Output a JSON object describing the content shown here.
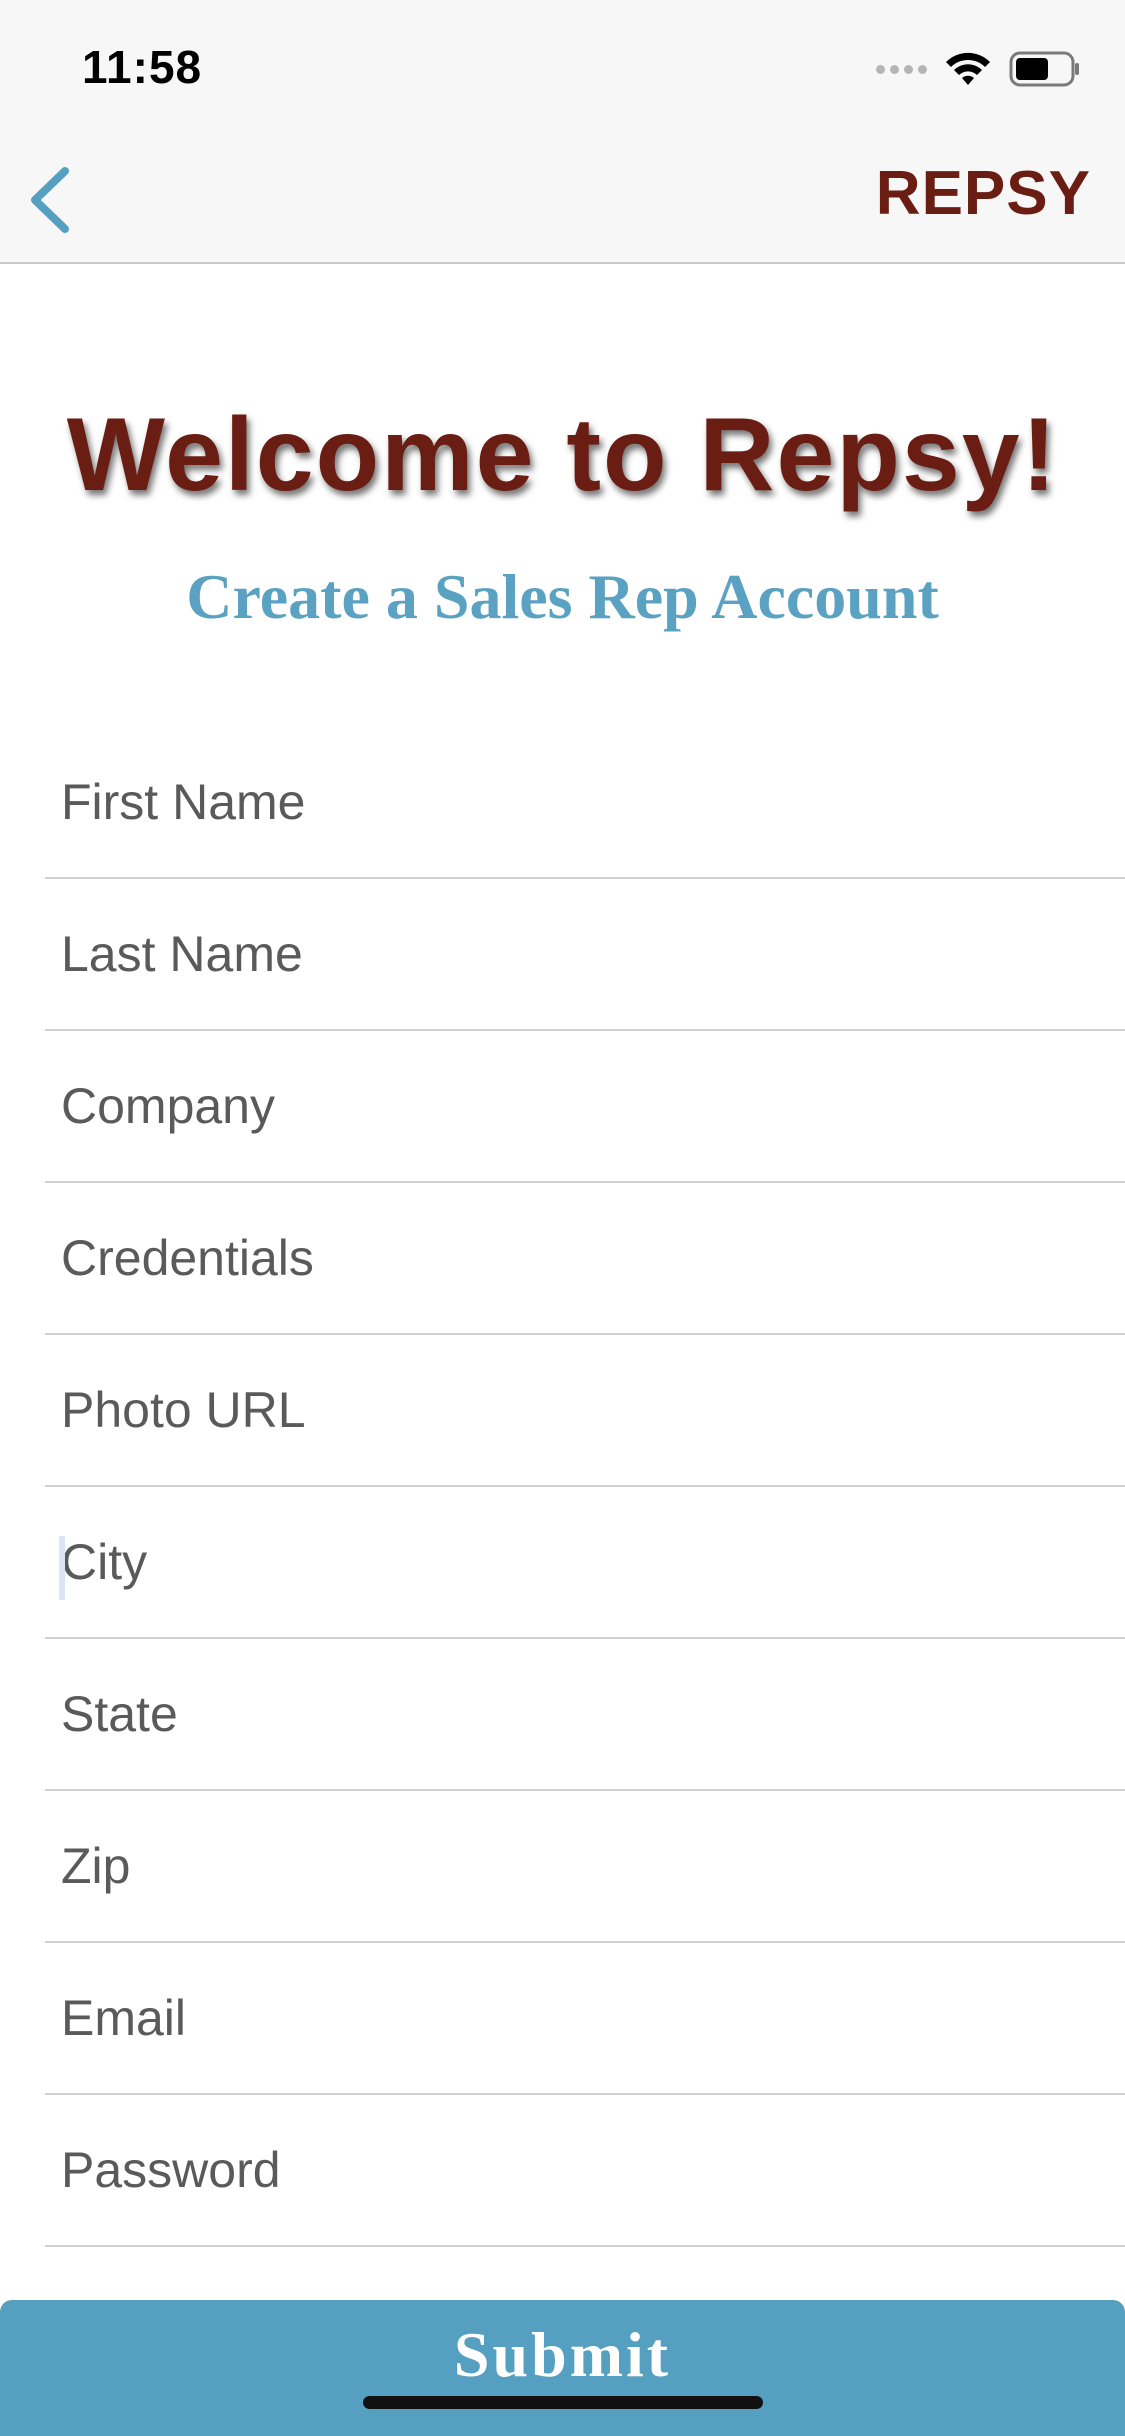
{
  "status_bar": {
    "time": "11:58",
    "icons": [
      "cellular-signal-icon",
      "wifi-icon",
      "battery-icon"
    ]
  },
  "nav": {
    "back_icon": "chevron-left-icon",
    "title": "REPSY"
  },
  "header": {
    "welcome": "Welcome to Repsy!",
    "subtitle": "Create a Sales Rep Account"
  },
  "form": {
    "fields": [
      {
        "placeholder": "First Name",
        "value": ""
      },
      {
        "placeholder": "Last Name",
        "value": ""
      },
      {
        "placeholder": "Company",
        "value": ""
      },
      {
        "placeholder": "Credentials",
        "value": ""
      },
      {
        "placeholder": "Photo URL",
        "value": ""
      },
      {
        "placeholder": "City",
        "value": ""
      },
      {
        "placeholder": "State",
        "value": ""
      },
      {
        "placeholder": "Zip",
        "value": ""
      },
      {
        "placeholder": "Email",
        "value": ""
      },
      {
        "placeholder": "Password",
        "value": ""
      }
    ],
    "focused_field": "City"
  },
  "submit": {
    "label": "Submit"
  },
  "colors": {
    "brand_dark_red": "#6a1d12",
    "accent_blue": "#559fc0",
    "subtitle_blue": "#5aa1c2",
    "nav_background": "#f7f7f7"
  }
}
